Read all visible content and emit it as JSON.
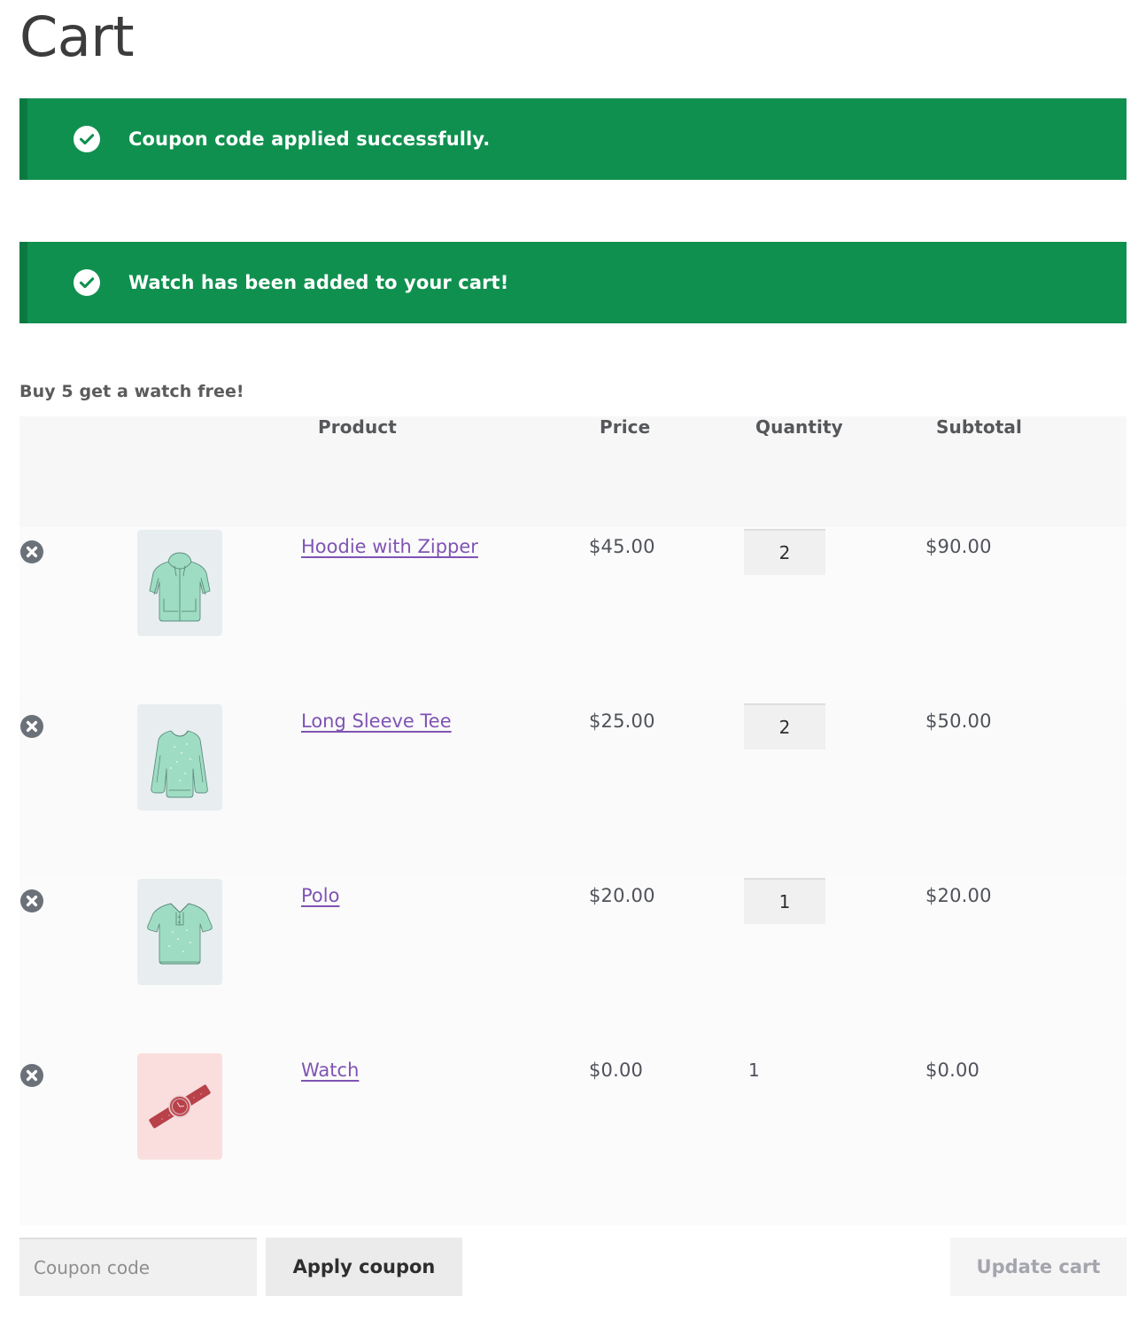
{
  "page": {
    "title": "Cart"
  },
  "notices": [
    {
      "icon": "check-circle-icon",
      "message": "Coupon code applied successfully."
    },
    {
      "icon": "check-circle-icon",
      "message": "Watch has been added to your cart!"
    }
  ],
  "promo": {
    "text": "Buy 5 get a watch free!"
  },
  "table": {
    "headers": {
      "remove": "",
      "thumbnail": "",
      "product": "Product",
      "price": "Price",
      "quantity": "Quantity",
      "subtotal": "Subtotal"
    },
    "rows": [
      {
        "remove_icon": "remove-item-icon",
        "thumbnail": "hoodie-with-zipper-thumbnail",
        "thumbnail_bg": "#e8eef0",
        "name": "Hoodie with Zipper",
        "price": "$45.00",
        "quantity": "2",
        "quantity_editable": true,
        "subtotal": "$90.00"
      },
      {
        "remove_icon": "remove-item-icon",
        "thumbnail": "long-sleeve-tee-thumbnail",
        "thumbnail_bg": "#e8eef0",
        "name": "Long Sleeve Tee",
        "price": "$25.00",
        "quantity": "2",
        "quantity_editable": true,
        "subtotal": "$50.00"
      },
      {
        "remove_icon": "remove-item-icon",
        "thumbnail": "polo-thumbnail",
        "thumbnail_bg": "#e8eef0",
        "name": "Polo",
        "price": "$20.00",
        "quantity": "1",
        "quantity_editable": true,
        "subtotal": "$20.00"
      },
      {
        "remove_icon": "remove-item-icon",
        "thumbnail": "watch-thumbnail",
        "thumbnail_bg": "#fadede",
        "name": "Watch",
        "price": "$0.00",
        "quantity": "1",
        "quantity_editable": false,
        "subtotal": "$0.00"
      }
    ]
  },
  "actions": {
    "coupon_placeholder": "Coupon code",
    "coupon_value": "",
    "apply_coupon_label": "Apply coupon",
    "update_cart_label": "Update cart",
    "update_cart_disabled": true
  },
  "colors": {
    "notice_bg": "#10904f",
    "notice_border": "#0b7a41",
    "link_purple": "#7f54b3",
    "header_bg": "#f7f7f7",
    "row_bg": "#fbfbfb",
    "input_bg": "#f0f0f0",
    "button_bg": "#ebebeb",
    "disabled_text": "#a5a5ad"
  }
}
